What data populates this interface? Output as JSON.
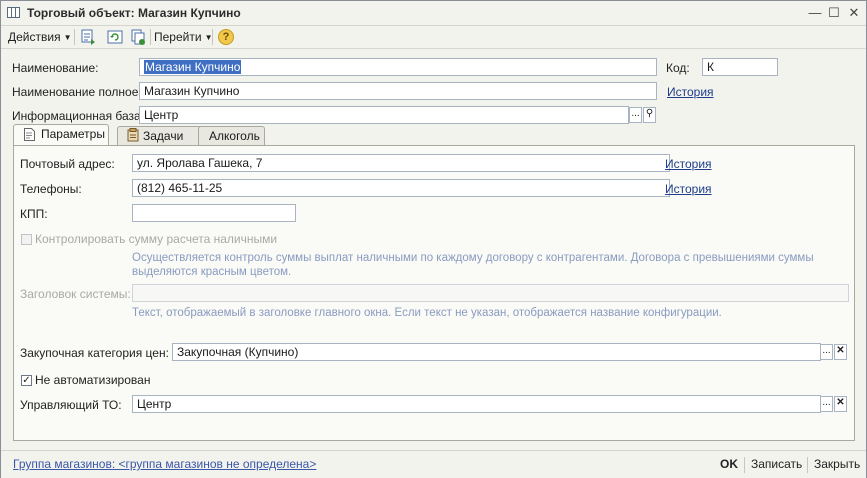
{
  "window": {
    "title": "Торговый объект: Магазин Купчино",
    "icon": "table-icon",
    "controls": [
      "minimize",
      "maximize",
      "close"
    ]
  },
  "toolbar": {
    "actions_label": "Действия",
    "goto_label": "Перейти",
    "help_label": "?"
  },
  "header": {
    "name_label": "Наименование:",
    "name_value": "Магазин Купчино",
    "code_label": "Код:",
    "code_value": "К",
    "fullname_label": "Наименование полное:",
    "fullname_value": "Магазин Купчино",
    "history_label": "История",
    "infobase_label": "Информационная база:",
    "infobase_value": "Центр"
  },
  "tabs": [
    {
      "label": "Параметры",
      "active": true
    },
    {
      "label": "Задачи",
      "active": false
    },
    {
      "label": "Алкоголь",
      "active": false
    }
  ],
  "params": {
    "address_label": "Почтовый адрес:",
    "address_value": "ул. Яролава Гашека, 7",
    "phones_label": "Телефоны:",
    "phones_value": "(812) 465-11-25",
    "history_label": "История",
    "kpp_label": "КПП:",
    "kpp_value": "",
    "control_cash_label": "Контролировать сумму расчета наличными",
    "control_cash_checked": false,
    "control_cash_note_1": "Осуществляется контроль суммы выплат наличными по каждому договору с контрагентами. Договора с превышениями суммы",
    "control_cash_note_2": "выделяются красным цветом.",
    "system_title_label": "Заголовок системы:",
    "system_title_value": "",
    "system_title_note": "Текст, отображаемый в заголовке главного окна. Если текст не указан, отображается название конфигурации.",
    "purchase_category_label": "Закупочная категория цен:",
    "purchase_category_value": "Закупочная (Купчино)",
    "not_automated_label": "Не автоматизирован",
    "not_automated_checked": true,
    "managing_label": "Управляющий ТО:",
    "managing_value": "Центр"
  },
  "footer": {
    "group_link": "Группа магазинов: <группа магазинов не определена>",
    "ok_label": "OK",
    "save_label": "Записать",
    "close_label": "Закрыть"
  },
  "colors": {
    "link": "#1f3d8a",
    "note": "#8a9bc0",
    "selection": "#3f6fc2"
  }
}
